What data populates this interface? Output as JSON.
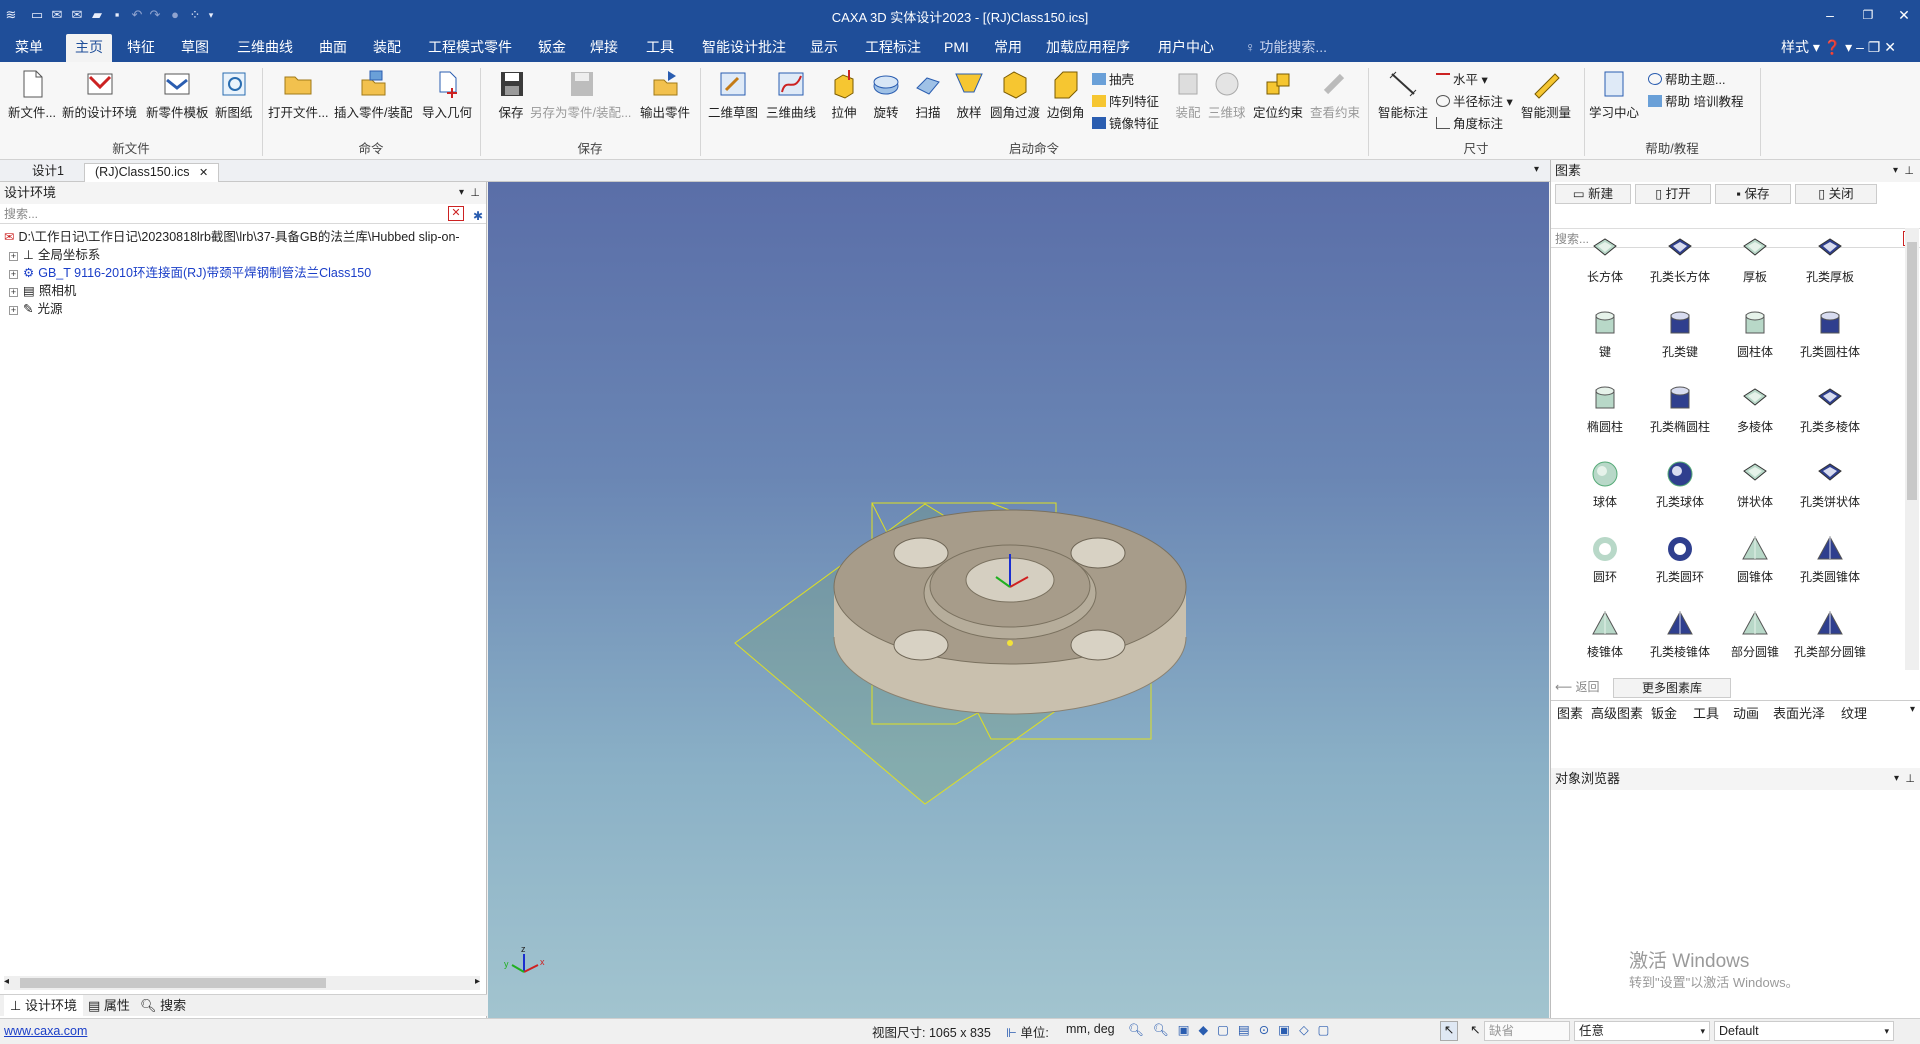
{
  "app": {
    "title": "CAXA 3D 实体设计2023 - [(RJ)Class150.ics]"
  },
  "menu": {
    "tabs": [
      "菜单",
      "主页",
      "特征",
      "草图",
      "三维曲线",
      "曲面",
      "装配",
      "工程模式零件",
      "钣金",
      "焊接",
      "工具",
      "智能设计批注",
      "显示",
      "工程标注",
      "PMI",
      "常用",
      "加载应用程序",
      "用户中心"
    ],
    "active": "主页",
    "search_placeholder": "功能搜索...",
    "style_label": "样式"
  },
  "ribbon": {
    "new_file": {
      "label": "新文件...",
      "group": "新文件"
    },
    "new_design_env": "新的设计环境",
    "new_part_template": "新零件模板",
    "new_drawing": "新图纸",
    "open_file": "打开文件...",
    "insert_part": "插入零件/装配",
    "import_geometry": "导入几何",
    "command_group": "命令",
    "save": "保存",
    "save_as_part": "另存为零件/装配...",
    "export_part": "输出零件",
    "save_group": "保存",
    "sketch_2d": "二维草图",
    "curve_3d": "三维曲线",
    "extrude": "拉伸",
    "revolve": "旋转",
    "sweep": "扫描",
    "loft": "放样",
    "fillet": "圆角过渡",
    "chamfer": "边倒角",
    "shell": "抽壳",
    "pattern": "阵列特征",
    "mirror": "镜像特征",
    "assembly": "装配",
    "three_d_ball": "三维球",
    "positioning_constraint": "定位约束",
    "view_constraint": "查看约束",
    "launch_group": "启动命令",
    "smart_dim": "智能标注",
    "horizontal": "水平",
    "radius_dim": "半径标注",
    "angle_dim": "角度标注",
    "smart_measure": "智能测量",
    "dim_group": "尺寸",
    "learning_center": "学习中心",
    "help_topic": "帮助主题...",
    "help_training": "帮助 培训教程",
    "help_group": "帮助/教程"
  },
  "doc_tabs": [
    "设计1",
    "(RJ)Class150.ics"
  ],
  "left_panel": {
    "title": "设计环境",
    "search_placeholder": "搜索...",
    "tree": [
      "D:\\工作日记\\工作日记\\20230818lrb截图\\lrb\\37-具备GB的法兰库\\Hubbed slip-on-",
      "全局坐标系",
      "GB_T 9116-2010环连接面(RJ)带颈平焊钢制管法兰Class150",
      "照相机",
      "光源"
    ],
    "bottom_tabs": [
      "设计环境",
      "属性",
      "搜索"
    ]
  },
  "right_panel": {
    "title": "图素",
    "buttons": [
      "新建",
      "打开",
      "保存",
      "关闭"
    ],
    "search_placeholder": "搜索...",
    "items": [
      "长方体",
      "孔类长方体",
      "厚板",
      "孔类厚板",
      "键",
      "孔类键",
      "圆柱体",
      "孔类圆柱体",
      "椭圆柱",
      "孔类椭圆柱",
      "多棱体",
      "孔类多棱体",
      "球体",
      "孔类球体",
      "饼状体",
      "孔类饼状体",
      "圆环",
      "孔类圆环",
      "圆锥体",
      "孔类圆锥体",
      "棱锥体",
      "孔类棱锥体",
      "部分圆锥",
      "孔类部分圆锥"
    ],
    "back_label": "返回",
    "more_label": "更多图素库",
    "lib_tabs": [
      "图素",
      "高级图素",
      "钣金",
      "工具",
      "动画",
      "表面光泽",
      "纹理"
    ],
    "object_browser": "对象浏览器"
  },
  "watermark": {
    "line1": "激活 Windows",
    "line2": "转到\"设置\"以激活 Windows。"
  },
  "status": {
    "url": "www.caxa.com",
    "view_size": "视图尺寸: 1065 x  835",
    "unit_label": "单位:",
    "unit_value": "mm, deg",
    "filter1": "缺省",
    "filter2": "任意",
    "filter3": "Default"
  },
  "colors": {
    "title_bar": "#1f4e99",
    "accent": "#1f4e99",
    "part": "#a79c8a"
  }
}
